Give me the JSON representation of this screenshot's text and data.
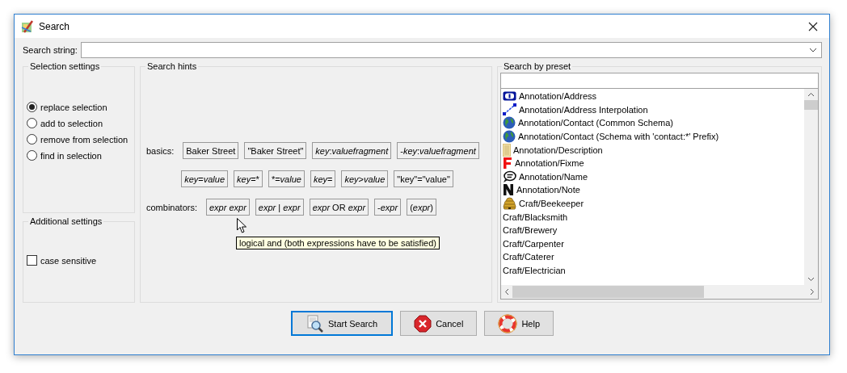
{
  "window": {
    "title": "Search"
  },
  "search_string": {
    "label": "Search string:"
  },
  "selection_settings": {
    "title": "Selection settings",
    "options": [
      {
        "label": "replace selection",
        "selected": true
      },
      {
        "label": "add to selection",
        "selected": false
      },
      {
        "label": "remove from selection",
        "selected": false
      },
      {
        "label": "find in selection",
        "selected": false
      }
    ]
  },
  "additional_settings": {
    "title": "Additional settings",
    "case_sensitive": {
      "label": "case sensitive",
      "checked": false
    }
  },
  "search_hints": {
    "title": "Search hints",
    "rows": [
      {
        "label": "basics:",
        "chips": [
          [
            {
              "text": "Baker Street",
              "italic": false
            }
          ],
          [
            {
              "text": "\"Baker Street\"",
              "italic": false
            }
          ],
          [
            {
              "text": "key",
              "italic": true
            },
            {
              "text": ":",
              "italic": false
            },
            {
              "text": "valuefragment",
              "italic": true
            }
          ],
          [
            {
              "text": "-",
              "italic": false
            },
            {
              "text": "key",
              "italic": true
            },
            {
              "text": ":",
              "italic": false
            },
            {
              "text": "valuefragment",
              "italic": true
            }
          ]
        ]
      },
      {
        "label": "",
        "chips": [
          [
            {
              "text": "key",
              "italic": true
            },
            {
              "text": "=",
              "italic": false
            },
            {
              "text": "value",
              "italic": true
            }
          ],
          [
            {
              "text": "key",
              "italic": true
            },
            {
              "text": "=*",
              "italic": false
            }
          ],
          [
            {
              "text": "*=",
              "italic": false
            },
            {
              "text": "value",
              "italic": true
            }
          ],
          [
            {
              "text": "key",
              "italic": true
            },
            {
              "text": "=",
              "italic": false
            }
          ],
          [
            {
              "text": "key",
              "italic": true
            },
            {
              "text": ">",
              "italic": false
            },
            {
              "text": "value",
              "italic": true
            }
          ],
          [
            {
              "text": "\"key\"=\"value\"",
              "italic": false
            }
          ]
        ]
      },
      {
        "label": "combinators:",
        "chips": [
          [
            {
              "text": "expr expr",
              "italic": true
            }
          ],
          [
            {
              "text": "expr",
              "italic": true
            },
            {
              "text": " | ",
              "italic": false
            },
            {
              "text": "expr",
              "italic": true
            }
          ],
          [
            {
              "text": "expr",
              "italic": true
            },
            {
              "text": " OR ",
              "italic": false
            },
            {
              "text": "expr",
              "italic": true
            }
          ],
          [
            {
              "text": "-",
              "italic": false
            },
            {
              "text": "expr",
              "italic": true
            }
          ],
          [
            {
              "text": "(",
              "italic": false
            },
            {
              "text": "expr",
              "italic": true
            },
            {
              "text": ")",
              "italic": false
            }
          ]
        ]
      }
    ],
    "tooltip": "logical and (both expressions have to be satisfied)"
  },
  "presets": {
    "title": "Search by preset",
    "items": [
      {
        "label": "Annotation/Address",
        "kind": "address"
      },
      {
        "label": "Annotation/Address Interpolation",
        "kind": "interpolation"
      },
      {
        "label": "Annotation/Contact (Common Schema)",
        "kind": "globe"
      },
      {
        "label": "Annotation/Contact (Schema with 'contact:*' Prefix)",
        "kind": "globe"
      },
      {
        "label": "Annotation/Description",
        "kind": "description"
      },
      {
        "label": "Annotation/Fixme",
        "kind": "fixme"
      },
      {
        "label": "Annotation/Name",
        "kind": "name"
      },
      {
        "label": "Annotation/Note",
        "kind": "note"
      },
      {
        "label": "Craft/Beekeeper",
        "kind": "beehive"
      },
      {
        "label": "Craft/Blacksmith",
        "kind": "plain"
      },
      {
        "label": "Craft/Brewery",
        "kind": "plain"
      },
      {
        "label": "Craft/Carpenter",
        "kind": "plain"
      },
      {
        "label": "Craft/Caterer",
        "kind": "plain"
      },
      {
        "label": "Craft/Electrician",
        "kind": "plain"
      }
    ]
  },
  "buttons": [
    {
      "label": "Start Search",
      "kind": "search",
      "default": true
    },
    {
      "label": "Cancel",
      "kind": "cancel",
      "default": false
    },
    {
      "label": "Help",
      "kind": "help",
      "default": false
    }
  ]
}
